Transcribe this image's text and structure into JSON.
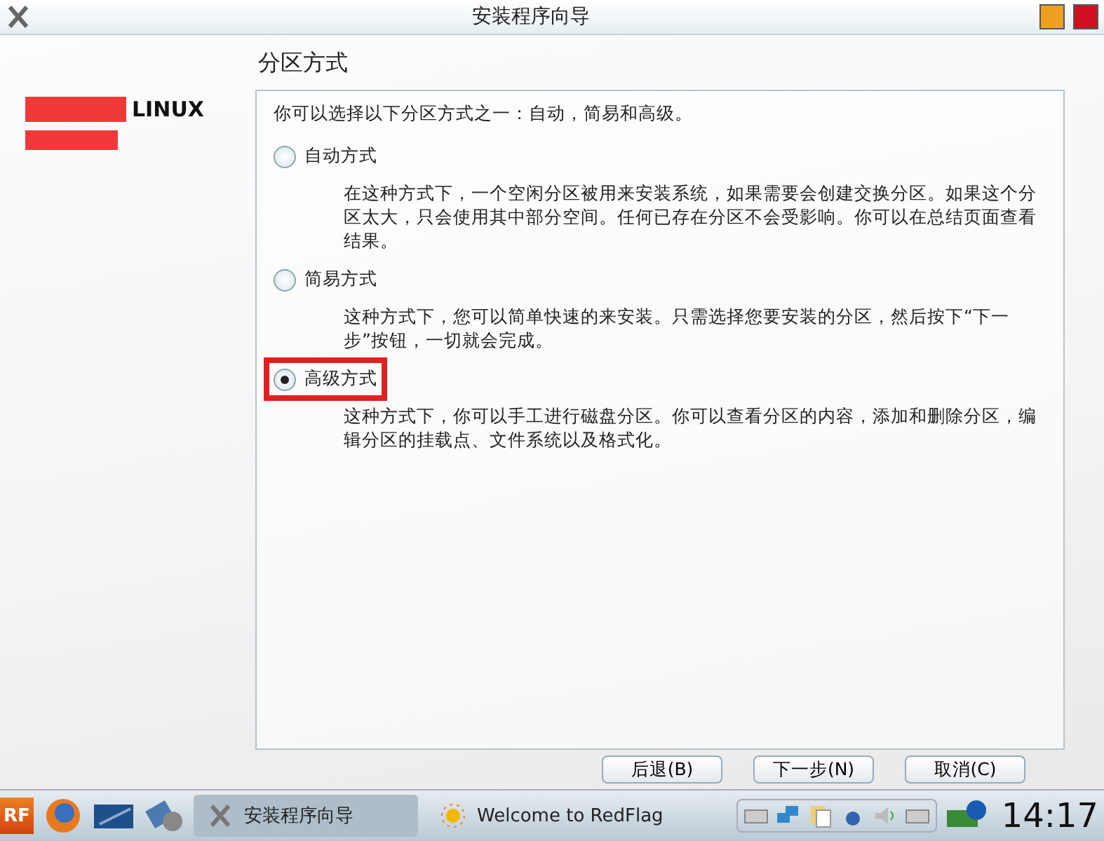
{
  "window": {
    "title": "安装程序向导"
  },
  "sidebar": {
    "logo_text": "LINUX"
  },
  "page": {
    "heading": "分区方式",
    "intro": "你可以选择以下分区方式之一：自动，简易和高级。",
    "options": [
      {
        "label": "自动方式",
        "selected": false,
        "highlighted": false,
        "description": "在这种方式下，一个空闲分区被用来安装系统，如果需要会创建交换分区。如果这个分区太大，只会使用其中部分空间。任何已存在分区不会受影响。你可以在总结页面查看结果。"
      },
      {
        "label": "简易方式",
        "selected": false,
        "highlighted": false,
        "description": "这种方式下，您可以简单快速的来安装。只需选择您要安装的分区，然后按下“下一步”按钮，一切就会完成。"
      },
      {
        "label": "高级方式",
        "selected": true,
        "highlighted": true,
        "description": "这种方式下，你可以手工进行磁盘分区。你可以查看分区的内容，添加和删除分区，编辑分区的挂载点、文件系统以及格式化。"
      }
    ]
  },
  "buttons": [
    "后退(B)",
    "下一步(N)",
    "取消(C)"
  ],
  "taskbar": {
    "start_label": "RF",
    "tasks": [
      {
        "label": "安装程序向导",
        "selected": true
      },
      {
        "label": "Welcome to RedFlag",
        "selected": false
      }
    ],
    "clock": "14:17"
  }
}
